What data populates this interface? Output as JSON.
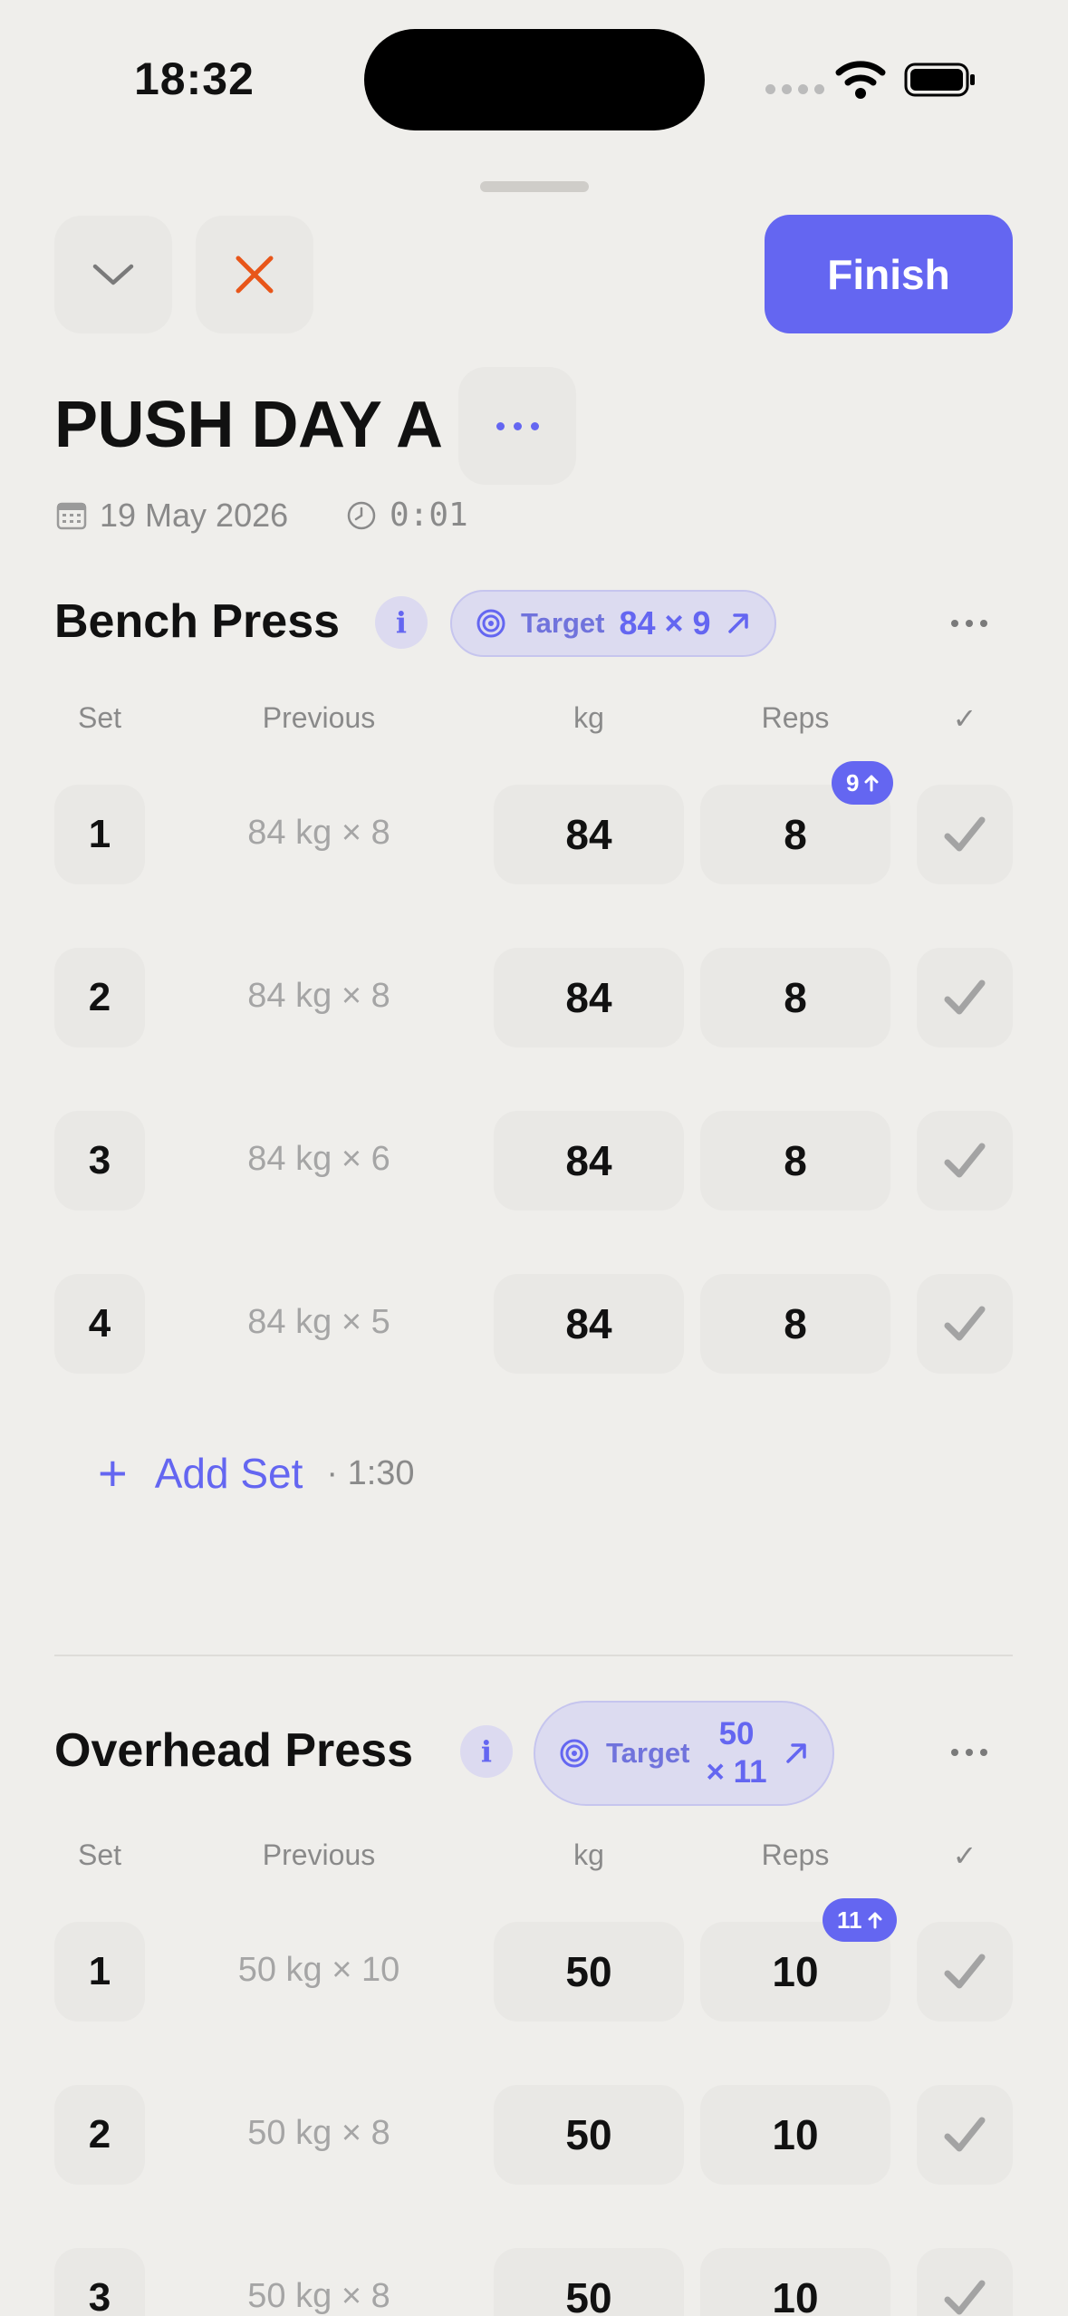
{
  "status_bar": {
    "time": "18:32"
  },
  "header": {
    "finish_label": "Finish"
  },
  "workout": {
    "title": "PUSH DAY A",
    "date": "19 May 2026",
    "duration": "0:01"
  },
  "columns": {
    "set": "Set",
    "previous": "Previous",
    "kg": "kg",
    "reps": "Reps",
    "done": "✓"
  },
  "exercises": [
    {
      "name": "Bench Press",
      "target_label": "Target",
      "target_value": "84 × 9",
      "badge": "9",
      "sets": [
        {
          "set": "1",
          "previous": "84 kg × 8",
          "kg": "84",
          "reps": "8"
        },
        {
          "set": "2",
          "previous": "84 kg × 8",
          "kg": "84",
          "reps": "8"
        },
        {
          "set": "3",
          "previous": "84 kg × 6",
          "kg": "84",
          "reps": "8"
        },
        {
          "set": "4",
          "previous": "84 kg × 5",
          "kg": "84",
          "reps": "8"
        }
      ],
      "add_set_label": "Add Set",
      "rest_time": "· 1:30"
    },
    {
      "name": "Overhead Press",
      "target_label": "Target",
      "target_value_line1": "50",
      "target_value_line2": "× 11",
      "badge": "11",
      "sets": [
        {
          "set": "1",
          "previous": "50 kg × 10",
          "kg": "50",
          "reps": "10"
        },
        {
          "set": "2",
          "previous": "50 kg × 8",
          "kg": "50",
          "reps": "10"
        },
        {
          "set": "3",
          "previous": "50 kg × 8",
          "kg": "50",
          "reps": "10"
        }
      ]
    }
  ],
  "colors": {
    "accent": "#6466f1",
    "close": "#e8561a",
    "background": "#efeeeb"
  }
}
